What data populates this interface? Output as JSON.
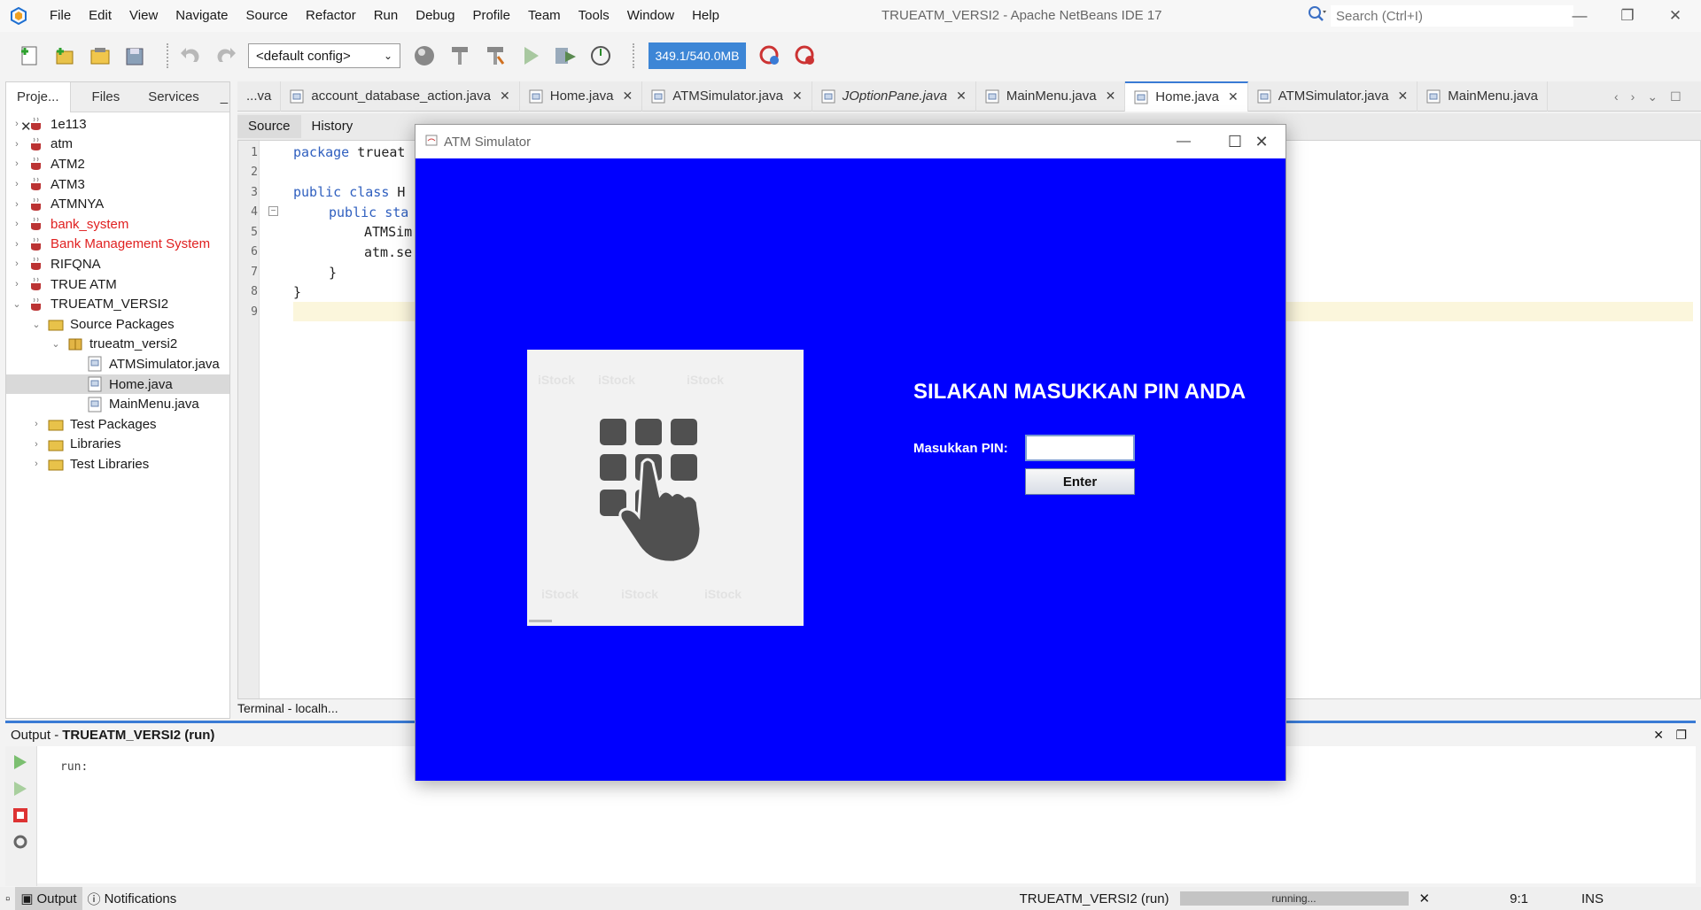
{
  "menubar": {
    "items": [
      "File",
      "Edit",
      "View",
      "Navigate",
      "Source",
      "Refactor",
      "Run",
      "Debug",
      "Profile",
      "Team",
      "Tools",
      "Window",
      "Help"
    ],
    "window_title": "TRUEATM_VERSI2 - Apache NetBeans IDE 17",
    "search_placeholder": "Search (Ctrl+I)"
  },
  "toolbar": {
    "config": "<default config>",
    "memory": "349.1/540.0MB"
  },
  "left_panel": {
    "tabs": [
      "Proje...",
      "Files",
      "Services"
    ],
    "tree": [
      {
        "label": "1e113",
        "level": 0,
        "arrow": "›",
        "red": false
      },
      {
        "label": "atm",
        "level": 0,
        "arrow": "›",
        "red": false
      },
      {
        "label": "ATM2",
        "level": 0,
        "arrow": "›",
        "red": false
      },
      {
        "label": "ATM3",
        "level": 0,
        "arrow": "›",
        "red": false
      },
      {
        "label": "ATMNYA",
        "level": 0,
        "arrow": "›",
        "red": false
      },
      {
        "label": "bank_system",
        "level": 0,
        "arrow": "›",
        "red": true
      },
      {
        "label": "Bank Management System",
        "level": 0,
        "arrow": "›",
        "red": true
      },
      {
        "label": "RIFQNA",
        "level": 0,
        "arrow": "›",
        "red": false
      },
      {
        "label": "TRUE ATM",
        "level": 0,
        "arrow": "›",
        "red": false
      },
      {
        "label": "TRUEATM_VERSI2",
        "level": 0,
        "arrow": "⌄",
        "red": false
      },
      {
        "label": "Source Packages",
        "level": 1,
        "arrow": "⌄",
        "red": false
      },
      {
        "label": "trueatm_versi2",
        "level": 2,
        "arrow": "⌄",
        "red": false
      },
      {
        "label": "ATMSimulator.java",
        "level": 3,
        "arrow": "",
        "red": false
      },
      {
        "label": "Home.java",
        "level": 3,
        "arrow": "",
        "red": false,
        "selected": true
      },
      {
        "label": "MainMenu.java",
        "level": 3,
        "arrow": "",
        "red": false
      },
      {
        "label": "Test Packages",
        "level": 1,
        "arrow": "›",
        "red": false
      },
      {
        "label": "Libraries",
        "level": 1,
        "arrow": "›",
        "red": false
      },
      {
        "label": "Test Libraries",
        "level": 1,
        "arrow": "›",
        "red": false
      }
    ]
  },
  "editor": {
    "tabs": [
      {
        "label": "...va",
        "active": false,
        "italic": false,
        "closable": false
      },
      {
        "label": "account_database_action.java",
        "active": false,
        "italic": false,
        "closable": true
      },
      {
        "label": "Home.java",
        "active": false,
        "italic": false,
        "closable": true
      },
      {
        "label": "ATMSimulator.java",
        "active": false,
        "italic": false,
        "closable": true
      },
      {
        "label": "JOptionPane.java",
        "active": false,
        "italic": true,
        "closable": true
      },
      {
        "label": "MainMenu.java",
        "active": false,
        "italic": false,
        "closable": true
      },
      {
        "label": "Home.java",
        "active": true,
        "italic": false,
        "closable": true
      },
      {
        "label": "ATMSimulator.java",
        "active": false,
        "italic": false,
        "closable": true
      },
      {
        "label": "MainMenu.java",
        "active": false,
        "italic": false,
        "closable": false
      }
    ],
    "source_tab": "Source",
    "history_tab": "History",
    "lines": [
      "1",
      "2",
      "3",
      "4",
      "5",
      "6",
      "7",
      "8",
      "9"
    ],
    "code": {
      "l1_kw": "package",
      "l1_rest": " trueat",
      "l3_kw": "public class",
      "l3_rest": " H",
      "l4_kw": "public sta",
      "l5": "ATMSim",
      "l6": "atm.se",
      "l7": "}",
      "l8": "}"
    },
    "terminal_label": "Terminal - localh..."
  },
  "output": {
    "title_prefix": "Output - ",
    "title_bold": "TRUEATM_VERSI2 (run)",
    "text": "run:"
  },
  "statusbar": {
    "output_tab": "Output",
    "notifications": "Notifications",
    "run_label": "TRUEATM_VERSI2 (run)",
    "progress_text": "running...",
    "position": "9:1",
    "mode": "INS"
  },
  "atm_window": {
    "title": "ATM Simulator",
    "heading": "SILAKAN MASUKKAN PIN ANDA",
    "pin_label": "Masukkan PIN:",
    "pin_value": "",
    "enter_label": "Enter",
    "background_color": "#0000ff",
    "watermark": "iStock"
  },
  "colors": {
    "accent": "#3a7bd5",
    "error_project": "#e02020",
    "memory_meter": "#3d86d6"
  }
}
